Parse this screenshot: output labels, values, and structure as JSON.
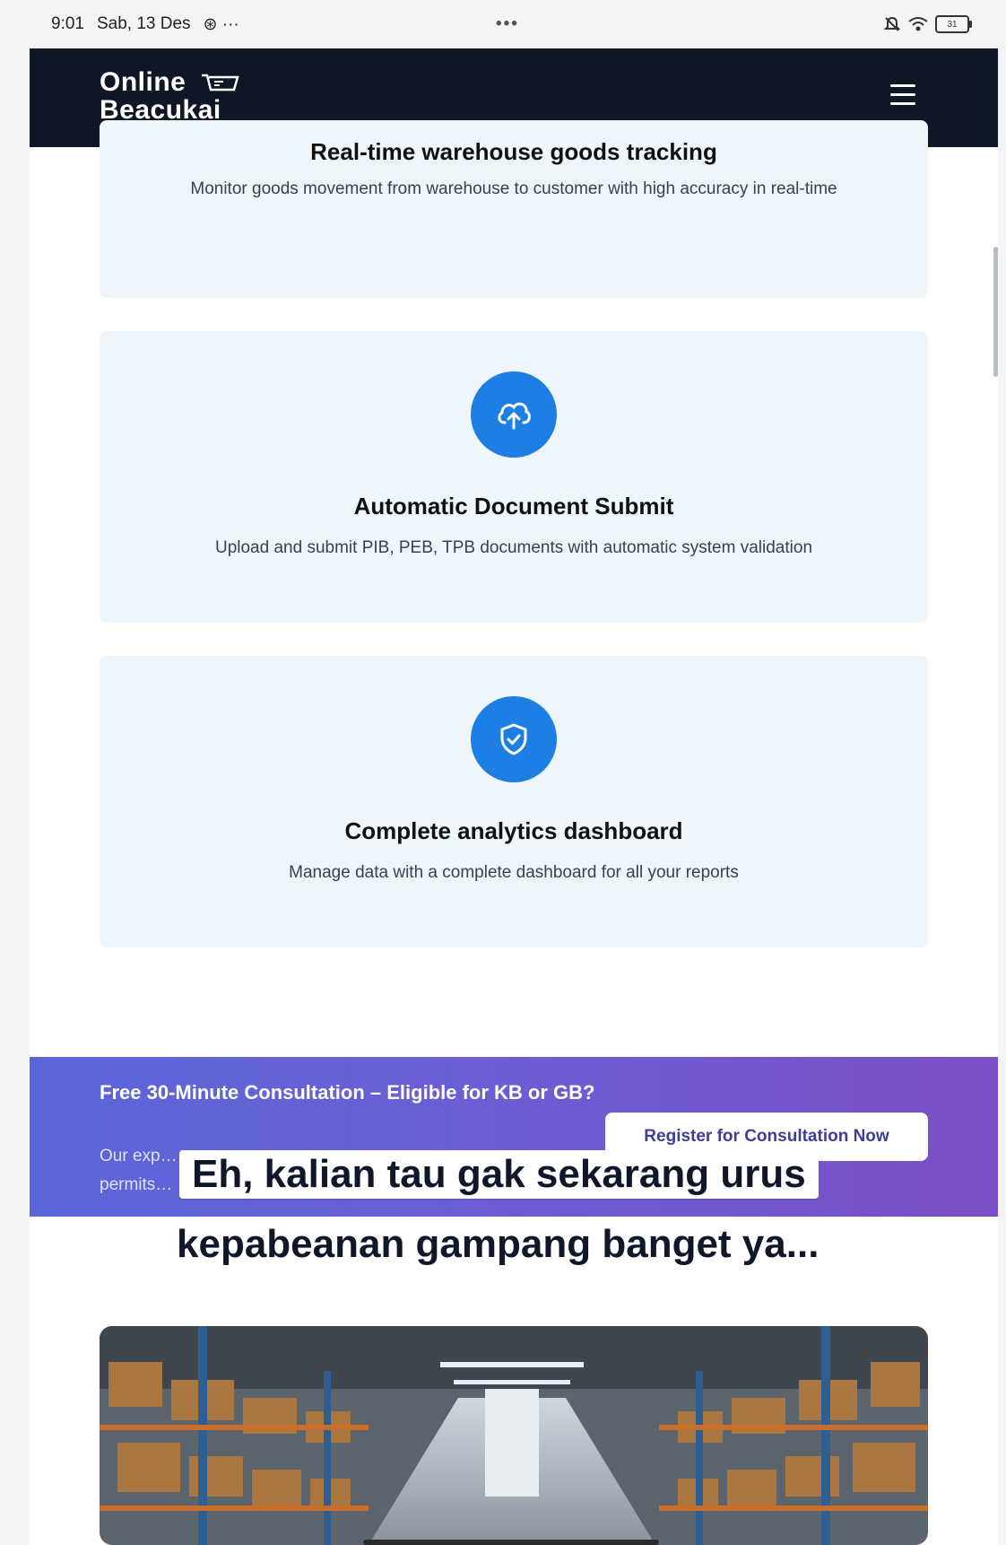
{
  "status_bar": {
    "time": "9:01",
    "date": "Sab, 13 Des",
    "extra": "⊛ ···",
    "center_dots": "•••",
    "battery": "31"
  },
  "header": {
    "logo_line1": "Online",
    "logo_line2": "Beacukai"
  },
  "features": [
    {
      "title": "Real-time warehouse goods tracking",
      "desc": "Monitor goods movement from warehouse to customer with high accuracy in real-time",
      "icon": "location-icon"
    },
    {
      "title": "Automatic Document Submit",
      "desc": "Upload and submit PIB, PEB, TPB documents with automatic system validation",
      "icon": "cloud-upload-icon"
    },
    {
      "title": "Complete analytics dashboard",
      "desc": "Manage data with a complete dashboard for all your reports",
      "icon": "shield-check-icon"
    }
  ],
  "banner": {
    "title": "Free 30-Minute Consultation – Eligible for KB or GB?",
    "subtitle": "Our exp… permits…",
    "button": "Register for Consultation Now"
  },
  "caption": {
    "line1": "Eh, kalian tau gak sekarang urus",
    "line2": "kepabeanan gampang banget ya..."
  },
  "colors": {
    "header_bg": "#0f1626",
    "accent_blue": "#1d7ee3",
    "card_bg": "#eef6fb",
    "banner_start": "#5a67d8",
    "banner_end": "#7a4fc7"
  }
}
